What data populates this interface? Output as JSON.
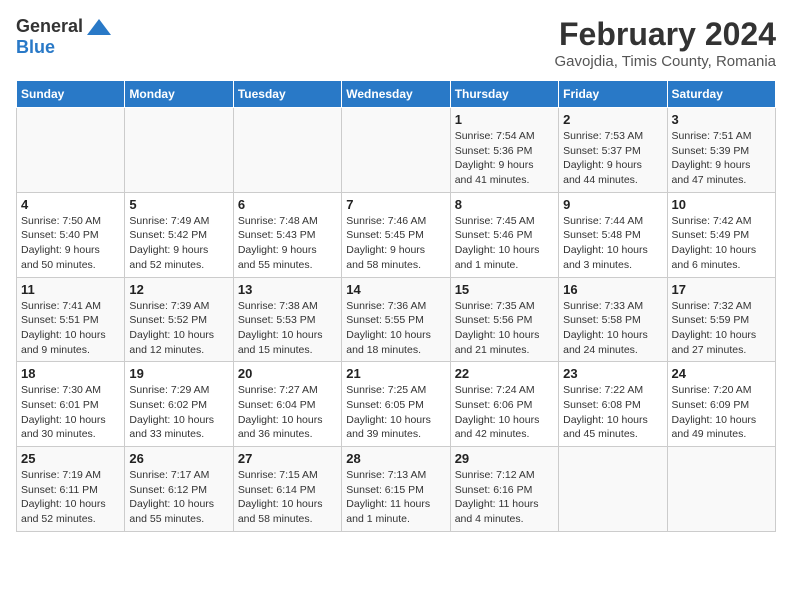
{
  "header": {
    "logo_general": "General",
    "logo_blue": "Blue",
    "month_title": "February 2024",
    "location": "Gavojdia, Timis County, Romania"
  },
  "days_of_week": [
    "Sunday",
    "Monday",
    "Tuesday",
    "Wednesday",
    "Thursday",
    "Friday",
    "Saturday"
  ],
  "weeks": [
    [
      {
        "day": "",
        "info": ""
      },
      {
        "day": "",
        "info": ""
      },
      {
        "day": "",
        "info": ""
      },
      {
        "day": "",
        "info": ""
      },
      {
        "day": "1",
        "info": "Sunrise: 7:54 AM\nSunset: 5:36 PM\nDaylight: 9 hours\nand 41 minutes."
      },
      {
        "day": "2",
        "info": "Sunrise: 7:53 AM\nSunset: 5:37 PM\nDaylight: 9 hours\nand 44 minutes."
      },
      {
        "day": "3",
        "info": "Sunrise: 7:51 AM\nSunset: 5:39 PM\nDaylight: 9 hours\nand 47 minutes."
      }
    ],
    [
      {
        "day": "4",
        "info": "Sunrise: 7:50 AM\nSunset: 5:40 PM\nDaylight: 9 hours\nand 50 minutes."
      },
      {
        "day": "5",
        "info": "Sunrise: 7:49 AM\nSunset: 5:42 PM\nDaylight: 9 hours\nand 52 minutes."
      },
      {
        "day": "6",
        "info": "Sunrise: 7:48 AM\nSunset: 5:43 PM\nDaylight: 9 hours\nand 55 minutes."
      },
      {
        "day": "7",
        "info": "Sunrise: 7:46 AM\nSunset: 5:45 PM\nDaylight: 9 hours\nand 58 minutes."
      },
      {
        "day": "8",
        "info": "Sunrise: 7:45 AM\nSunset: 5:46 PM\nDaylight: 10 hours\nand 1 minute."
      },
      {
        "day": "9",
        "info": "Sunrise: 7:44 AM\nSunset: 5:48 PM\nDaylight: 10 hours\nand 3 minutes."
      },
      {
        "day": "10",
        "info": "Sunrise: 7:42 AM\nSunset: 5:49 PM\nDaylight: 10 hours\nand 6 minutes."
      }
    ],
    [
      {
        "day": "11",
        "info": "Sunrise: 7:41 AM\nSunset: 5:51 PM\nDaylight: 10 hours\nand 9 minutes."
      },
      {
        "day": "12",
        "info": "Sunrise: 7:39 AM\nSunset: 5:52 PM\nDaylight: 10 hours\nand 12 minutes."
      },
      {
        "day": "13",
        "info": "Sunrise: 7:38 AM\nSunset: 5:53 PM\nDaylight: 10 hours\nand 15 minutes."
      },
      {
        "day": "14",
        "info": "Sunrise: 7:36 AM\nSunset: 5:55 PM\nDaylight: 10 hours\nand 18 minutes."
      },
      {
        "day": "15",
        "info": "Sunrise: 7:35 AM\nSunset: 5:56 PM\nDaylight: 10 hours\nand 21 minutes."
      },
      {
        "day": "16",
        "info": "Sunrise: 7:33 AM\nSunset: 5:58 PM\nDaylight: 10 hours\nand 24 minutes."
      },
      {
        "day": "17",
        "info": "Sunrise: 7:32 AM\nSunset: 5:59 PM\nDaylight: 10 hours\nand 27 minutes."
      }
    ],
    [
      {
        "day": "18",
        "info": "Sunrise: 7:30 AM\nSunset: 6:01 PM\nDaylight: 10 hours\nand 30 minutes."
      },
      {
        "day": "19",
        "info": "Sunrise: 7:29 AM\nSunset: 6:02 PM\nDaylight: 10 hours\nand 33 minutes."
      },
      {
        "day": "20",
        "info": "Sunrise: 7:27 AM\nSunset: 6:04 PM\nDaylight: 10 hours\nand 36 minutes."
      },
      {
        "day": "21",
        "info": "Sunrise: 7:25 AM\nSunset: 6:05 PM\nDaylight: 10 hours\nand 39 minutes."
      },
      {
        "day": "22",
        "info": "Sunrise: 7:24 AM\nSunset: 6:06 PM\nDaylight: 10 hours\nand 42 minutes."
      },
      {
        "day": "23",
        "info": "Sunrise: 7:22 AM\nSunset: 6:08 PM\nDaylight: 10 hours\nand 45 minutes."
      },
      {
        "day": "24",
        "info": "Sunrise: 7:20 AM\nSunset: 6:09 PM\nDaylight: 10 hours\nand 49 minutes."
      }
    ],
    [
      {
        "day": "25",
        "info": "Sunrise: 7:19 AM\nSunset: 6:11 PM\nDaylight: 10 hours\nand 52 minutes."
      },
      {
        "day": "26",
        "info": "Sunrise: 7:17 AM\nSunset: 6:12 PM\nDaylight: 10 hours\nand 55 minutes."
      },
      {
        "day": "27",
        "info": "Sunrise: 7:15 AM\nSunset: 6:14 PM\nDaylight: 10 hours\nand 58 minutes."
      },
      {
        "day": "28",
        "info": "Sunrise: 7:13 AM\nSunset: 6:15 PM\nDaylight: 11 hours\nand 1 minute."
      },
      {
        "day": "29",
        "info": "Sunrise: 7:12 AM\nSunset: 6:16 PM\nDaylight: 11 hours\nand 4 minutes."
      },
      {
        "day": "",
        "info": ""
      },
      {
        "day": "",
        "info": ""
      }
    ]
  ]
}
